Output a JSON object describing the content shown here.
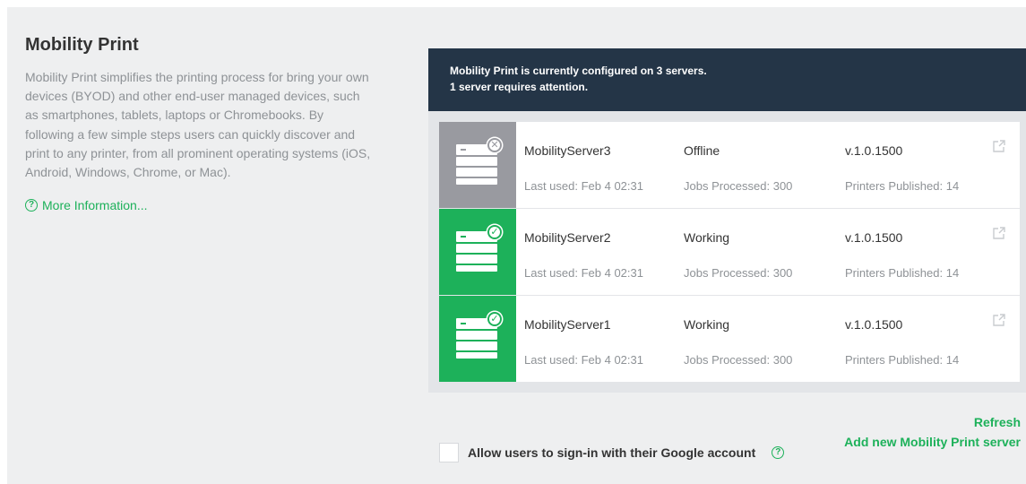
{
  "page": {
    "title": "Mobility Print",
    "description": "Mobility Print simplifies the printing process for bring your own devices (BYOD) and other end-user managed devices, such as smartphones, tablets, laptops or Chromebooks. By following a few simple steps users can quickly discover and print to any printer, from all prominent operating systems (iOS, Android, Windows, Chrome, or Mac).",
    "more_info": "More Information..."
  },
  "banner": {
    "line1": "Mobility Print is currently configured on 3 servers.",
    "line2": "1 server requires attention."
  },
  "servers": [
    {
      "name": "MobilityServer3",
      "status": "Offline",
      "version": "v.1.0.1500",
      "last_used": "Last used:  Feb 4 02:31",
      "jobs": "Jobs Processed:  300",
      "printers": "Printers Published:  14",
      "icon": "server-offline-icon",
      "color": "#999aa0"
    },
    {
      "name": "MobilityServer2",
      "status": "Working",
      "version": "v.1.0.1500",
      "last_used": "Last used:  Feb 4 02:31",
      "jobs": "Jobs Processed:  300",
      "printers": "Printers Published:  14",
      "icon": "server-working-icon",
      "color": "#1db15a"
    },
    {
      "name": "MobilityServer1",
      "status": "Working",
      "version": "v.1.0.1500",
      "last_used": "Last used:  Feb 4 02:31",
      "jobs": "Jobs Processed:  300",
      "printers": "Printers Published:  14",
      "icon": "server-working-icon",
      "color": "#1db15a"
    }
  ],
  "actions": {
    "refresh": "Refresh",
    "add_server": "Add new Mobility Print server"
  },
  "google_signin": {
    "label": "Allow users to sign-in with their Google account",
    "checked": false
  },
  "colors": {
    "accent": "#1db15a",
    "banner_bg": "#243547",
    "offline": "#999aa0",
    "panel_bg": "#eeeff0"
  }
}
